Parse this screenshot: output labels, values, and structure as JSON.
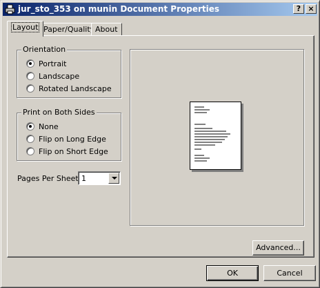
{
  "window": {
    "title": "jur_sto_353 on munin Document Properties",
    "help_glyph": "?",
    "close_glyph": "×",
    "app_icon": "printer-icon"
  },
  "tabs": [
    {
      "label": "Layout",
      "active": true
    },
    {
      "label": "Paper/Quality",
      "active": false
    },
    {
      "label": "About",
      "active": false
    }
  ],
  "orientation": {
    "label": "Orientation",
    "options": [
      {
        "label": "Portrait",
        "checked": true
      },
      {
        "label": "Landscape",
        "checked": false
      },
      {
        "label": "Rotated Landscape",
        "checked": false
      }
    ]
  },
  "duplex": {
    "label": "Print on Both Sides",
    "options": [
      {
        "label": "None",
        "checked": true
      },
      {
        "label": "Flip on Long Edge",
        "checked": false
      },
      {
        "label": "Flip on Short Edge",
        "checked": false
      }
    ]
  },
  "pages_per_sheet": {
    "label": "Pages Per Sheet:",
    "value": "1"
  },
  "buttons": {
    "advanced": "Advanced...",
    "ok": "OK",
    "cancel": "Cancel"
  },
  "colors": {
    "face": "#d4d0c8",
    "title_start": "#0a246a",
    "title_end": "#a6caf0"
  }
}
